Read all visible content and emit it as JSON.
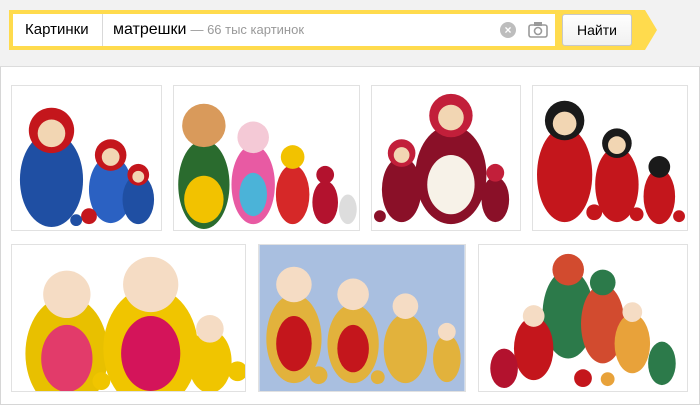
{
  "search": {
    "service_label": "Картинки",
    "query": "матрешки",
    "hint": "— 66 тыс картинок",
    "button_label": "Найти"
  },
  "results": [
    {
      "id": "img-1",
      "icon": "matryoshka-image"
    },
    {
      "id": "img-2",
      "icon": "matryoshka-image"
    },
    {
      "id": "img-3",
      "icon": "matryoshka-image"
    },
    {
      "id": "img-4",
      "icon": "matryoshka-image"
    },
    {
      "id": "img-5",
      "icon": "matryoshka-image"
    },
    {
      "id": "img-6",
      "icon": "matryoshka-image"
    },
    {
      "id": "img-7",
      "icon": "matryoshka-image"
    }
  ],
  "colors": {
    "accent": "#ffdb4d",
    "doll_red": "#c4161c",
    "doll_yellow": "#f2c200",
    "doll_blue": "#1f4fa3"
  }
}
